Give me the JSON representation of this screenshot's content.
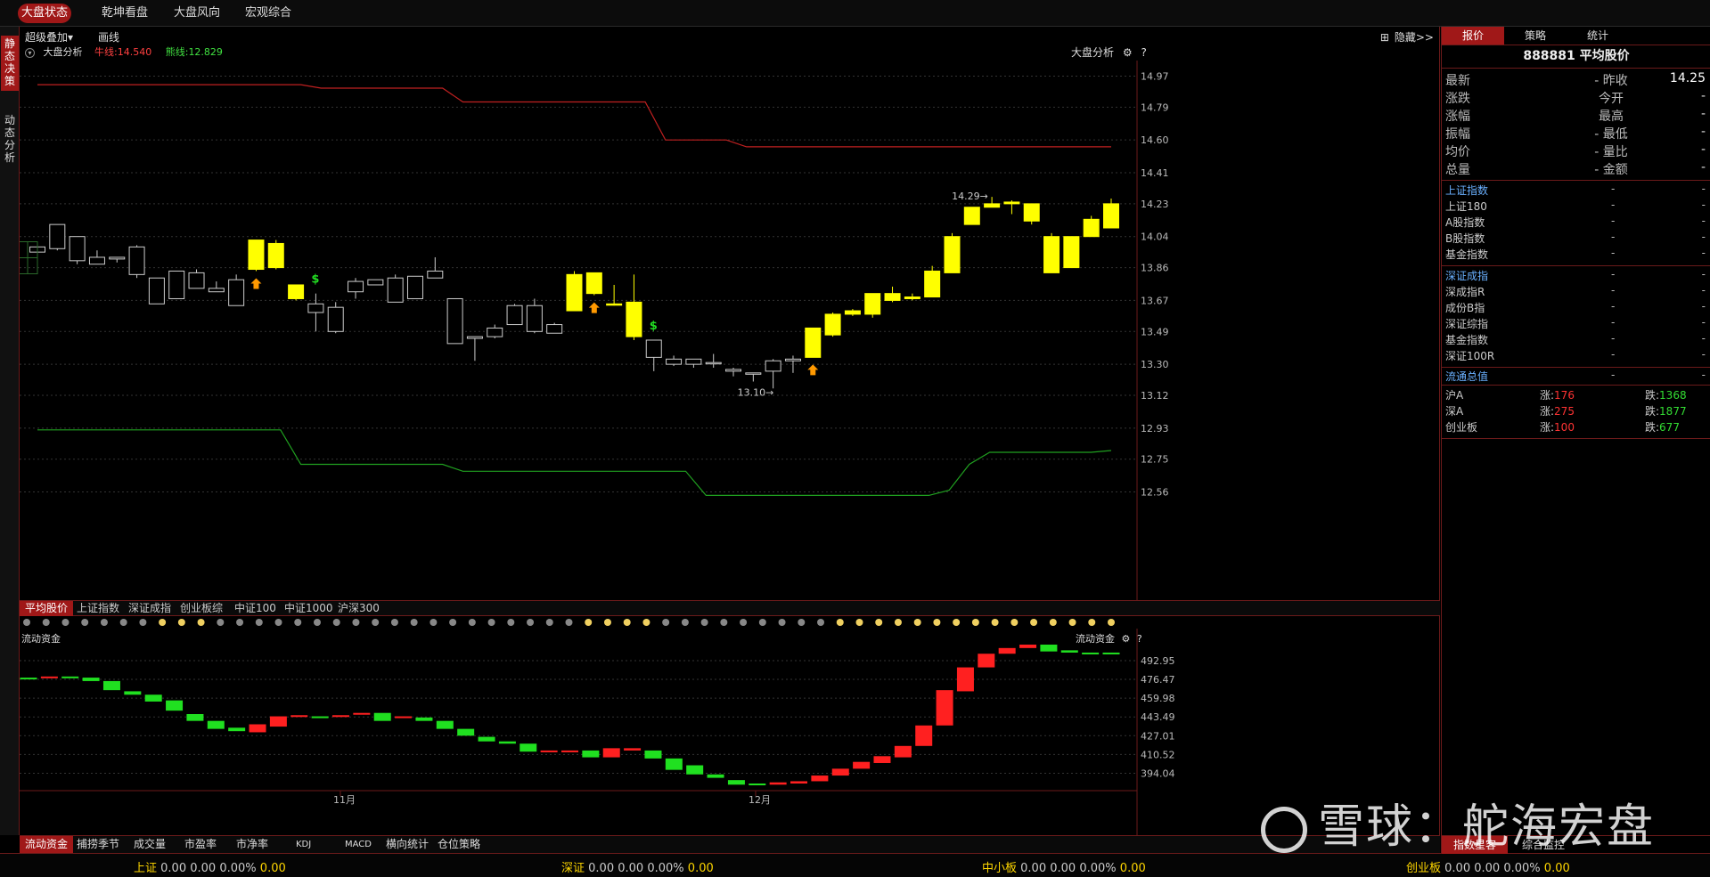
{
  "top_tabs": [
    "大盘状态",
    "乾坤看盘",
    "大盘风向",
    "宏观综合"
  ],
  "left_tabs": [
    "静态决策",
    "动态分析"
  ],
  "toolbar": {
    "overlay": "超级叠加",
    "draw": "画线",
    "hide": "隐藏>>"
  },
  "main_chart": {
    "name": "大盘分析",
    "bull_label": "牛线:",
    "bull_value": "14.540",
    "bear_label": "熊线:",
    "bear_value": "12.829",
    "title_right": "大盘分析",
    "y_ticks": [
      "14.97",
      "14.79",
      "14.60",
      "14.41",
      "14.23",
      "14.04",
      "13.86",
      "13.67",
      "13.49",
      "13.30",
      "13.12",
      "12.93",
      "12.75",
      "12.56"
    ],
    "high_annot": "14.29→",
    "low_annot": "13.10→"
  },
  "chart_data": {
    "type": "candlestick",
    "ylim": [
      12.47,
      15.06
    ],
    "bull_line": [
      14.92,
      14.92,
      14.92,
      14.92,
      14.92,
      14.92,
      14.92,
      14.92,
      14.92,
      14.92,
      14.92,
      14.92,
      14.92,
      14.92,
      14.9,
      14.9,
      14.9,
      14.9,
      14.9,
      14.9,
      14.9,
      14.82,
      14.82,
      14.82,
      14.82,
      14.82,
      14.82,
      14.82,
      14.82,
      14.82,
      14.82,
      14.6,
      14.6,
      14.6,
      14.6,
      14.56,
      14.56,
      14.56,
      14.56,
      14.56,
      14.56,
      14.56,
      14.56,
      14.56,
      14.56,
      14.56,
      14.56,
      14.56,
      14.56,
      14.56,
      14.56,
      14.56,
      14.56,
      14.56
    ],
    "bear_line": [
      12.92,
      12.92,
      12.92,
      12.92,
      12.92,
      12.92,
      12.92,
      12.92,
      12.92,
      12.92,
      12.92,
      12.92,
      12.92,
      12.72,
      12.72,
      12.72,
      12.72,
      12.72,
      12.72,
      12.72,
      12.72,
      12.68,
      12.68,
      12.68,
      12.68,
      12.68,
      12.68,
      12.68,
      12.68,
      12.68,
      12.68,
      12.68,
      12.68,
      12.54,
      12.54,
      12.54,
      12.54,
      12.54,
      12.54,
      12.54,
      12.54,
      12.54,
      12.54,
      12.54,
      12.54,
      12.57,
      12.72,
      12.79,
      12.79,
      12.79,
      12.79,
      12.79,
      12.79,
      12.8
    ],
    "candles": [
      [
        13.96,
        13.98,
        13.95,
        13.98,
        0
      ],
      [
        14.11,
        14.11,
        13.97,
        13.96,
        0
      ],
      [
        14.04,
        14.04,
        13.9,
        13.88,
        0
      ],
      [
        13.96,
        13.92,
        13.88,
        13.89,
        0
      ],
      [
        13.91,
        13.91,
        13.92,
        13.89,
        0
      ],
      [
        13.99,
        13.98,
        13.82,
        13.8,
        0
      ],
      [
        13.74,
        13.8,
        13.65,
        13.65,
        0
      ],
      [
        13.84,
        13.84,
        13.68,
        13.68,
        0
      ],
      [
        13.85,
        13.83,
        13.74,
        13.74,
        0
      ],
      [
        13.78,
        13.74,
        13.72,
        13.73,
        0
      ],
      [
        13.82,
        13.79,
        13.64,
        13.64,
        0
      ],
      [
        14.02,
        14.02,
        13.85,
        13.84,
        1
      ],
      [
        14.02,
        14.0,
        13.86,
        13.85,
        1
      ],
      [
        13.76,
        13.76,
        13.68,
        13.67,
        1
      ],
      [
        13.71,
        13.65,
        13.6,
        13.49,
        0
      ],
      [
        13.66,
        13.63,
        13.49,
        13.48,
        0
      ],
      [
        13.8,
        13.78,
        13.72,
        13.68,
        0
      ],
      [
        13.79,
        13.79,
        13.76,
        13.76,
        0
      ],
      [
        13.82,
        13.8,
        13.66,
        13.66,
        0
      ],
      [
        13.81,
        13.81,
        13.68,
        13.68,
        0
      ],
      [
        13.92,
        13.84,
        13.8,
        13.8,
        0
      ],
      [
        13.68,
        13.68,
        13.42,
        13.42,
        0
      ],
      [
        13.46,
        13.46,
        13.45,
        13.32,
        0
      ],
      [
        13.53,
        13.51,
        13.46,
        13.45,
        0
      ],
      [
        13.65,
        13.64,
        13.53,
        13.53,
        0
      ],
      [
        13.68,
        13.64,
        13.49,
        13.48,
        0
      ],
      [
        13.54,
        13.53,
        13.48,
        13.48,
        0
      ],
      [
        13.84,
        13.82,
        13.61,
        13.61,
        1
      ],
      [
        13.83,
        13.83,
        13.71,
        13.7,
        1
      ],
      [
        13.76,
        13.65,
        13.65,
        13.64,
        1
      ],
      [
        13.82,
        13.66,
        13.46,
        13.44,
        1
      ],
      [
        13.44,
        13.44,
        13.34,
        13.26,
        0
      ],
      [
        13.35,
        13.33,
        13.3,
        13.29,
        0
      ],
      [
        13.33,
        13.33,
        13.3,
        13.28,
        0
      ],
      [
        13.36,
        13.31,
        13.31,
        13.28,
        0
      ],
      [
        13.28,
        13.27,
        13.26,
        13.23,
        0
      ],
      [
        13.25,
        13.25,
        13.25,
        13.2,
        0
      ],
      [
        13.33,
        13.32,
        13.26,
        13.16,
        0
      ],
      [
        13.35,
        13.33,
        13.32,
        13.25,
        0
      ],
      [
        13.51,
        13.51,
        13.34,
        13.34,
        1
      ],
      [
        13.6,
        13.59,
        13.47,
        13.46,
        1
      ],
      [
        13.62,
        13.61,
        13.59,
        13.58,
        1
      ],
      [
        13.71,
        13.71,
        13.59,
        13.57,
        1
      ],
      [
        13.75,
        13.71,
        13.67,
        13.66,
        1
      ],
      [
        13.71,
        13.69,
        13.68,
        13.67,
        1
      ],
      [
        13.87,
        13.84,
        13.69,
        13.69,
        1
      ],
      [
        14.06,
        14.04,
        13.83,
        13.83,
        1
      ],
      [
        14.21,
        14.21,
        14.11,
        14.11,
        1
      ],
      [
        14.27,
        14.23,
        14.21,
        14.21,
        1
      ],
      [
        14.25,
        14.23,
        14.24,
        14.17,
        1
      ],
      [
        14.23,
        14.23,
        14.13,
        14.11,
        1
      ],
      [
        14.06,
        14.04,
        13.83,
        13.83,
        1
      ],
      [
        14.04,
        14.04,
        13.86,
        13.86,
        1
      ],
      [
        14.16,
        14.14,
        14.04,
        14.04,
        1
      ],
      [
        14.26,
        14.23,
        14.09,
        14.09,
        1
      ]
    ],
    "buy_signals": [
      11,
      28,
      39
    ],
    "sell_signals": [
      14,
      31
    ]
  },
  "indicator_tabs": [
    "平均股价",
    "上证指数",
    "深证成指",
    "创业板综",
    "中证100",
    "中证1000",
    "沪深300"
  ],
  "dots": [
    "g",
    "g",
    "g",
    "g",
    "g",
    "g",
    "g",
    "y",
    "y",
    "y",
    "g",
    "g",
    "g",
    "g",
    "g",
    "g",
    "g",
    "g",
    "g",
    "g",
    "g",
    "g",
    "g",
    "g",
    "g",
    "g",
    "g",
    "g",
    "g",
    "y",
    "y",
    "y",
    "y",
    "g",
    "g",
    "g",
    "g",
    "g",
    "g",
    "g",
    "g",
    "g",
    "y",
    "y",
    "y",
    "y",
    "y",
    "y",
    "y",
    "y",
    "y",
    "y",
    "y",
    "y",
    "y",
    "y",
    "y"
  ],
  "flow_chart": {
    "name": "流动资金",
    "title_right": "流动资金",
    "y_ticks": [
      "492.95",
      "476.47",
      "459.98",
      "443.49",
      "427.01",
      "410.52",
      "394.04"
    ],
    "x_labels": [
      "11月",
      "12月"
    ],
    "ylim": [
      385,
      507
    ],
    "bars": [
      [
        478,
        477,
        0
      ],
      [
        478,
        479,
        1
      ],
      [
        478,
        479,
        0
      ],
      [
        478,
        475,
        0
      ],
      [
        475,
        467,
        0
      ],
      [
        466,
        463,
        0
      ],
      [
        463,
        457,
        0
      ],
      [
        458,
        449,
        0
      ],
      [
        446,
        440,
        0
      ],
      [
        440,
        433,
        0
      ],
      [
        434,
        431,
        0
      ],
      [
        430,
        437,
        1
      ],
      [
        435,
        444,
        1
      ],
      [
        444,
        445,
        1
      ],
      [
        444,
        444,
        0
      ],
      [
        444,
        445,
        1
      ],
      [
        446,
        447,
        1
      ],
      [
        447,
        440,
        0
      ],
      [
        444,
        443,
        1
      ],
      [
        443,
        440,
        0
      ],
      [
        440,
        433,
        0
      ],
      [
        433,
        427,
        0
      ],
      [
        426,
        422,
        0
      ],
      [
        422,
        420,
        0
      ],
      [
        420,
        413,
        0
      ],
      [
        413,
        414,
        1
      ],
      [
        413,
        414,
        1
      ],
      [
        414,
        408,
        0
      ],
      [
        408,
        416,
        1
      ],
      [
        416,
        414,
        1
      ],
      [
        414,
        407,
        0
      ],
      [
        407,
        397,
        0
      ],
      [
        401,
        393,
        0
      ],
      [
        393,
        390,
        0
      ],
      [
        388,
        384,
        0
      ],
      [
        385,
        384,
        0
      ],
      [
        384,
        386,
        1
      ],
      [
        385,
        387,
        1
      ],
      [
        387,
        392,
        1
      ],
      [
        392,
        398,
        1
      ],
      [
        398,
        404,
        1
      ],
      [
        403,
        409,
        1
      ],
      [
        408,
        418,
        1
      ],
      [
        418,
        436,
        1
      ],
      [
        436,
        467,
        1
      ],
      [
        466,
        487,
        1
      ],
      [
        487,
        499,
        1
      ],
      [
        499,
        504,
        1
      ],
      [
        504,
        507,
        1
      ],
      [
        507,
        501,
        0
      ],
      [
        502,
        500,
        0
      ],
      [
        500,
        499,
        0
      ],
      [
        500,
        499,
        0
      ]
    ]
  },
  "bottom_tabs": [
    "流动资金",
    "捕捞季节",
    "成交量",
    "市盈率",
    "市净率",
    "KDJ",
    "MACD",
    "横向统计",
    "仓位策略"
  ],
  "status": [
    {
      "name": "上证",
      "v1": "0.00",
      "v2": "0.00",
      "pct": "0.00%",
      "v3": "0.00"
    },
    {
      "name": "深证",
      "v1": "0.00",
      "v2": "0.00",
      "pct": "0.00%",
      "v3": "0.00"
    },
    {
      "name": "中小板",
      "v1": "0.00",
      "v2": "0.00",
      "pct": "0.00%",
      "v3": "0.00"
    },
    {
      "name": "创业板",
      "v1": "0.00",
      "v2": "0.00",
      "pct": "0.00%",
      "v3": "0.00"
    }
  ],
  "right_panel": {
    "tabs": [
      "报价",
      "策略",
      "统计"
    ],
    "title": "888881 平均股价",
    "quote_rows": [
      {
        "l": "最新",
        "m": "- 昨收",
        "r": "14.25"
      },
      {
        "l": "涨跌",
        "m": "今开",
        "r": "-"
      },
      {
        "l": "涨幅",
        "m": "最高",
        "r": "-"
      },
      {
        "l": "振幅",
        "m": "- 最低",
        "r": "-"
      },
      {
        "l": "均价",
        "m": "- 量比",
        "r": "-"
      },
      {
        "l": "总量",
        "m": "- 金额",
        "r": "-"
      }
    ],
    "index_rows_1": [
      {
        "l": "上证指数",
        "m": "-",
        "r": "-"
      },
      {
        "l": "上证180",
        "m": "-",
        "r": "-"
      },
      {
        "l": "A股指数",
        "m": "-",
        "r": "-"
      },
      {
        "l": "B股指数",
        "m": "-",
        "r": "-"
      },
      {
        "l": "基金指数",
        "m": "-",
        "r": "-"
      }
    ],
    "index_rows_2": [
      {
        "l": "深证成指",
        "m": "-",
        "r": "-"
      },
      {
        "l": "深成指R",
        "m": "-",
        "r": "-"
      },
      {
        "l": "成份B指",
        "m": "-",
        "r": "-"
      },
      {
        "l": "深证综指",
        "m": "-",
        "r": "-"
      },
      {
        "l": "基金指数",
        "m": "-",
        "r": "-"
      },
      {
        "l": "深证100R",
        "m": "-",
        "r": "-"
      }
    ],
    "float_row": {
      "l": "流通总值",
      "m": "-",
      "r": "-"
    },
    "breadth": [
      {
        "l": "沪A",
        "up_label": "涨:",
        "up": "176",
        "down_label": "跌:",
        "down": "1368"
      },
      {
        "l": "深A",
        "up_label": "涨:",
        "up": "275",
        "down_label": "跌:",
        "down": "1877"
      },
      {
        "l": "创业板",
        "up_label": "涨:",
        "up": "100",
        "down_label": "跌:",
        "down": "677"
      }
    ],
    "bottom_tabs": [
      "指数星客",
      "综合监控"
    ]
  },
  "watermark": "雪球：舵海宏盘",
  "colors": {
    "accent": "#a01818",
    "up": "#ff2020",
    "down": "#20e020",
    "candle_yellow": "#ffff00",
    "bull_line": "#c02020",
    "bear_line": "#20a020"
  }
}
